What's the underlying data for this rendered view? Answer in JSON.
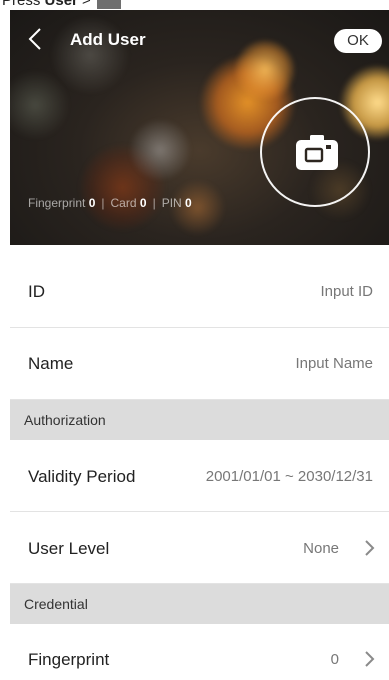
{
  "caption": {
    "prefix": "Press ",
    "bold": "User",
    "suffix": " > "
  },
  "header": {
    "title": "Add User",
    "ok_label": "OK"
  },
  "summary": {
    "fingerprint_label": "Fingerprint",
    "fingerprint_count": "0",
    "card_label": "Card",
    "card_count": "0",
    "pin_label": "PIN",
    "pin_count": "0",
    "separator": "|"
  },
  "rows": {
    "id": {
      "label": "ID",
      "placeholder": "Input ID"
    },
    "name": {
      "label": "Name",
      "placeholder": "Input Name"
    }
  },
  "sections": {
    "authorization": "Authorization",
    "credential": "Credential"
  },
  "authorization": {
    "validity": {
      "label": "Validity Period",
      "value": "2001/01/01 ~ 2030/12/31"
    },
    "user_level": {
      "label": "User Level",
      "value": "None"
    }
  },
  "credential": {
    "fingerprint": {
      "label": "Fingerprint",
      "value": "0"
    }
  },
  "icons": [
    "back-chevron-icon",
    "camera-icon",
    "chevron-right-icon"
  ]
}
